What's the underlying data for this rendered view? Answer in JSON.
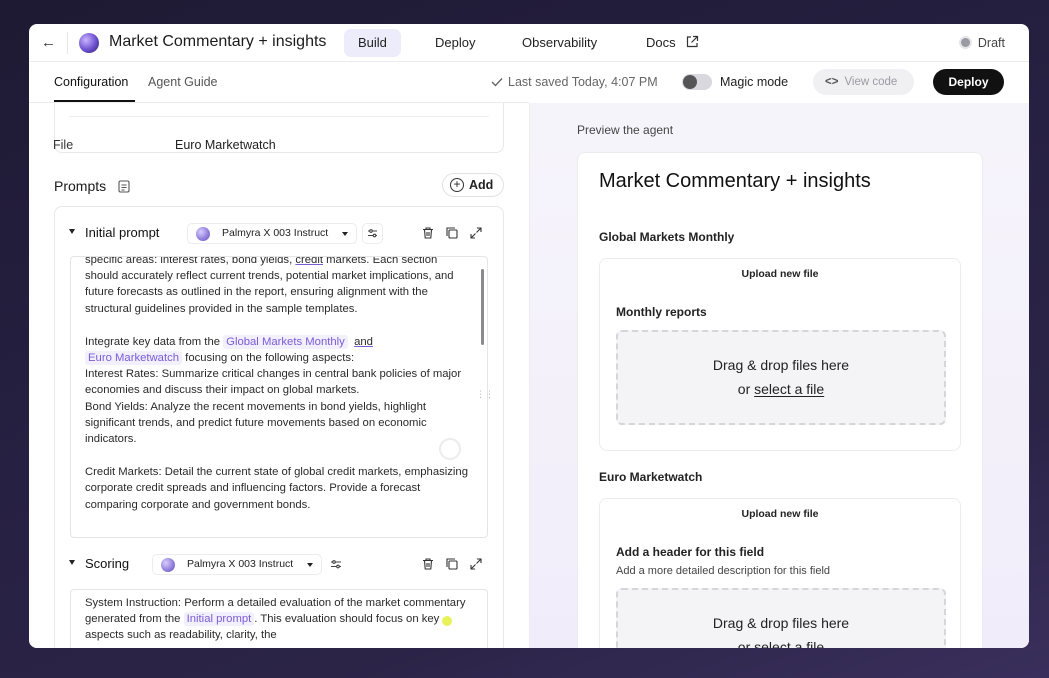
{
  "header": {
    "back_label": "←",
    "app_title": "Market Commentary + insights",
    "tabs": [
      {
        "label": "Build"
      },
      {
        "label": "Deploy"
      },
      {
        "label": "Observability"
      },
      {
        "label": "Docs"
      }
    ],
    "status": "Draft"
  },
  "subbar": {
    "tabs": [
      {
        "label": "Configuration"
      },
      {
        "label": "Agent Guide"
      }
    ],
    "saved_text": "Last saved Today, 4:07 PM",
    "magic_label": "Magic mode",
    "magic_enabled": false,
    "view_code_label": "View code",
    "deploy_label": "Deploy"
  },
  "config": {
    "file_label": "File",
    "file_value": "Euro Marketwatch",
    "prompts_heading": "Prompts",
    "add_label": "Add",
    "prompts": [
      {
        "name": "Initial prompt",
        "model": "Palmyra X 003 Instruct",
        "text": {
          "l1_a": "specific areas: interest rates, bond yields, ",
          "l1_credit": "credit",
          "l1_b": " markets. Each section should accurately reflect current trends, potential market implications, and future forecasts as outlined in the report, ensuring alignment with the structural guidelines provided in the sample templates.",
          "p2_a": "Integrate key data from the ",
          "p2_tag1": "Global Markets Monthly",
          "p2_and": "and",
          "p2_tag2": "Euro Marketwatch",
          "p2_b": " focusing on the following aspects:",
          "p2_c": "Interest Rates: Summarize critical changes in central bank policies of major economies and discuss their impact on global markets.",
          "p2_d": "Bond Yields: Analyze the recent movements in bond yields, highlight significant trends, and predict future movements based on economic indicators.",
          "p3": "Credit Markets: Detail the current state of global credit markets, emphasizing corporate credit spreads and influencing factors. Provide a forecast comparing corporate and government bonds."
        }
      },
      {
        "name": "Scoring",
        "model": "Palmyra X 003 Instruct",
        "text": {
          "a": "System Instruction: Perform a detailed evaluation of the market commentary generated from the ",
          "tag": "Initial prompt",
          "b": ". This evaluation should focus on key aspects such as readability, clarity, the"
        }
      }
    ]
  },
  "preview": {
    "label": "Preview the agent",
    "title": "Market Commentary + insights",
    "fields": [
      {
        "heading": "Global Markets Monthly",
        "upload_new": "Upload new file",
        "subheading": "Monthly reports",
        "dz_main": "Drag & drop files here",
        "dz_or": "or ",
        "dz_link": "select a file"
      },
      {
        "heading": "Euro Marketwatch",
        "upload_new": "Upload new file",
        "subheading": "Add a header for this field",
        "description": "Add a more detailed description for this field",
        "dz_main": "Drag & drop files here",
        "dz_or": "or ",
        "dz_link": "select a file"
      }
    ]
  }
}
